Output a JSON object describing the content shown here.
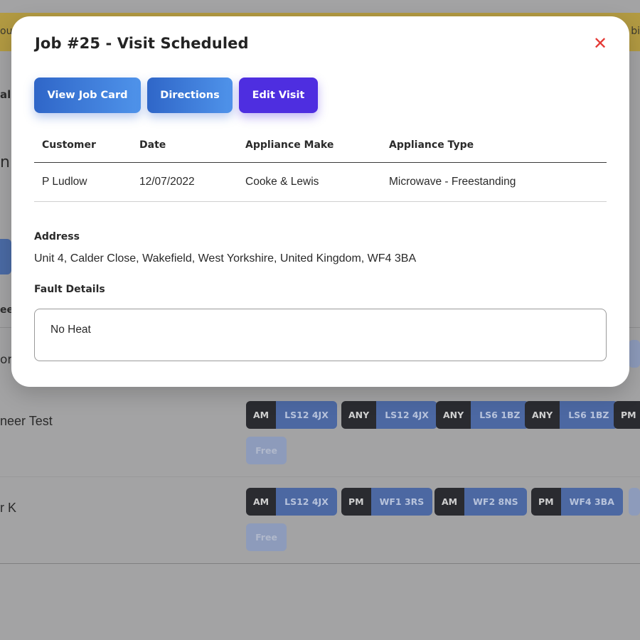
{
  "background": {
    "banner_left_fragment": "ou",
    "banner_right_fragment": "bi",
    "nav_fragment": "al",
    "heading_fragment": "n",
    "column_fragment": "ee",
    "row_top_fragment": "or",
    "rows": [
      {
        "name": "neer Test",
        "slots": [
          {
            "time": "AM",
            "postcode": "LS12 4JX"
          },
          {
            "time": "ANY",
            "postcode": "LS12 4JX"
          },
          {
            "time": "ANY",
            "postcode": "LS6 1BZ"
          },
          {
            "time": "ANY",
            "postcode": "LS6 1BZ"
          },
          {
            "time": "PM",
            "postcode": ""
          }
        ],
        "free_label": "Free"
      },
      {
        "name": "r K",
        "slots": [
          {
            "time": "AM",
            "postcode": "LS12 4JX"
          },
          {
            "time": "PM",
            "postcode": "WF1 3RS"
          },
          {
            "time": "AM",
            "postcode": "WF2 8NS"
          },
          {
            "time": "PM",
            "postcode": "WF4 3BA"
          }
        ],
        "free_label": "Free"
      }
    ]
  },
  "modal": {
    "title": "Job #25 - Visit Scheduled",
    "close_glyph": "✕",
    "buttons": {
      "view_job_card": "View Job Card",
      "directions": "Directions",
      "edit_visit": "Edit Visit"
    },
    "table": {
      "headers": [
        "Customer",
        "Date",
        "Appliance Make",
        "Appliance Type"
      ],
      "row": [
        "P Ludlow",
        "12/07/2022",
        "Cooke & Lewis",
        "Microwave - Freestanding"
      ]
    },
    "address_label": "Address",
    "address": "Unit 4, Calder Close, Wakefield, West Yorkshire, United Kingdom, WF4 3BA",
    "fault_label": "Fault Details",
    "fault_details": "No Heat"
  },
  "colors": {
    "overlay": "#a3a3a4",
    "banner": "#b29a42",
    "primary_blue": "#3a78d8",
    "edit_purple": "#4e2ee0",
    "close_red": "#e53935",
    "slot_time": "#2a2b30",
    "slot_postcode": "#4c68a2"
  }
}
